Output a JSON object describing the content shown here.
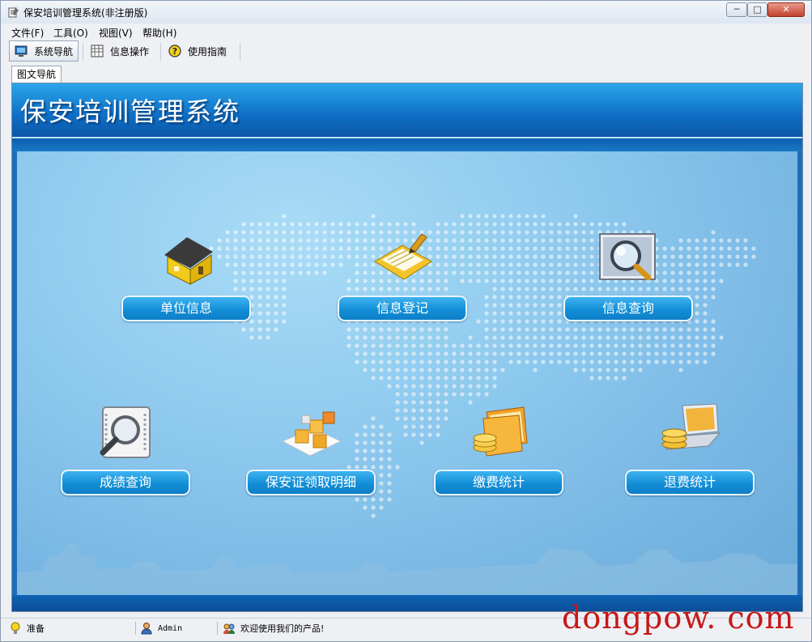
{
  "window": {
    "title": "保安培训管理系统(非注册版)",
    "controls": {
      "minimize": "─",
      "maximize": "□",
      "close": "✕"
    }
  },
  "menu": [
    "文件(F)",
    "工具(O)",
    "视图(V)",
    "帮助(H)"
  ],
  "toolbar": [
    {
      "label": "系统导航",
      "icon": "monitor-icon",
      "active": true
    },
    {
      "label": "信息操作",
      "icon": "grid-icon",
      "active": false
    },
    {
      "label": "使用指南",
      "icon": "help-icon",
      "active": false
    }
  ],
  "tab": {
    "label": "图文导航"
  },
  "banner": {
    "title": "保安培训管理系统"
  },
  "nav": [
    {
      "label": "单位信息",
      "icon": "house-icon"
    },
    {
      "label": "信息登记",
      "icon": "clipboard-pen-icon"
    },
    {
      "label": "信息查询",
      "icon": "magnifier-screen-icon"
    },
    {
      "label": "成绩查询",
      "icon": "magnifier-document-icon"
    },
    {
      "label": "保安证领取明细",
      "icon": "boxes-icon"
    },
    {
      "label": "缴费统计",
      "icon": "folder-coins-icon"
    },
    {
      "label": "退费统计",
      "icon": "laptop-coins-icon"
    }
  ],
  "status": {
    "state": "准备",
    "user": "Admin",
    "message": "欢迎使用我们的产品!"
  },
  "watermark": "dongpow. com",
  "colors": {
    "accent": "#1a8fd8",
    "banner": "#0f6ec5",
    "watermark": "#c61818"
  }
}
